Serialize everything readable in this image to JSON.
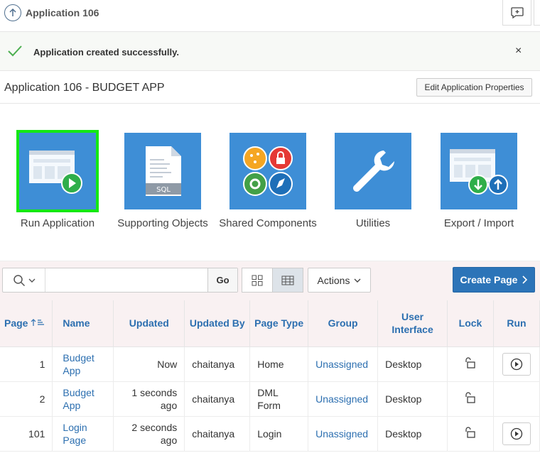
{
  "header": {
    "title": "Application 106"
  },
  "alert": {
    "message": "Application created successfully.",
    "close": "×"
  },
  "app": {
    "name": "Application 106 - BUDGET APP",
    "edit_label": "Edit Application Properties"
  },
  "tiles": [
    {
      "label": "Run Application",
      "icon": "run-app-icon"
    },
    {
      "label": "Supporting Objects",
      "icon": "sql-file-icon"
    },
    {
      "label": "Shared Components",
      "icon": "shared-components-icon"
    },
    {
      "label": "Utilities",
      "icon": "wrench-icon"
    },
    {
      "label": "Export / Import",
      "icon": "export-import-icon"
    }
  ],
  "toolbar": {
    "search_placeholder": "",
    "go_label": "Go",
    "actions_label": "Actions",
    "create_label": "Create Page"
  },
  "table": {
    "columns": [
      "Page",
      "Name",
      "Updated",
      "Updated By",
      "Page Type",
      "Group",
      "User Interface",
      "Lock",
      "Run"
    ],
    "rows": [
      {
        "page": "1",
        "name": "Budget App",
        "updated": "Now",
        "updated_by": "chaitanya",
        "type": "Home",
        "group": "Unassigned",
        "ui": "Desktop",
        "run": true
      },
      {
        "page": "2",
        "name": "Budget App",
        "updated": "1 seconds ago",
        "updated_by": "chaitanya",
        "type": "DML Form",
        "group": "Unassigned",
        "ui": "Desktop",
        "run": false
      },
      {
        "page": "101",
        "name": "Login Page",
        "updated": "2 seconds ago",
        "updated_by": "chaitanya",
        "type": "Login",
        "group": "Unassigned",
        "ui": "Desktop",
        "run": true
      }
    ]
  },
  "colors": {
    "tile": "#3e8ed6",
    "primary": "#2c74b8",
    "selected": "#14e814",
    "link": "#2c6fb0",
    "success": "#4caf50"
  }
}
